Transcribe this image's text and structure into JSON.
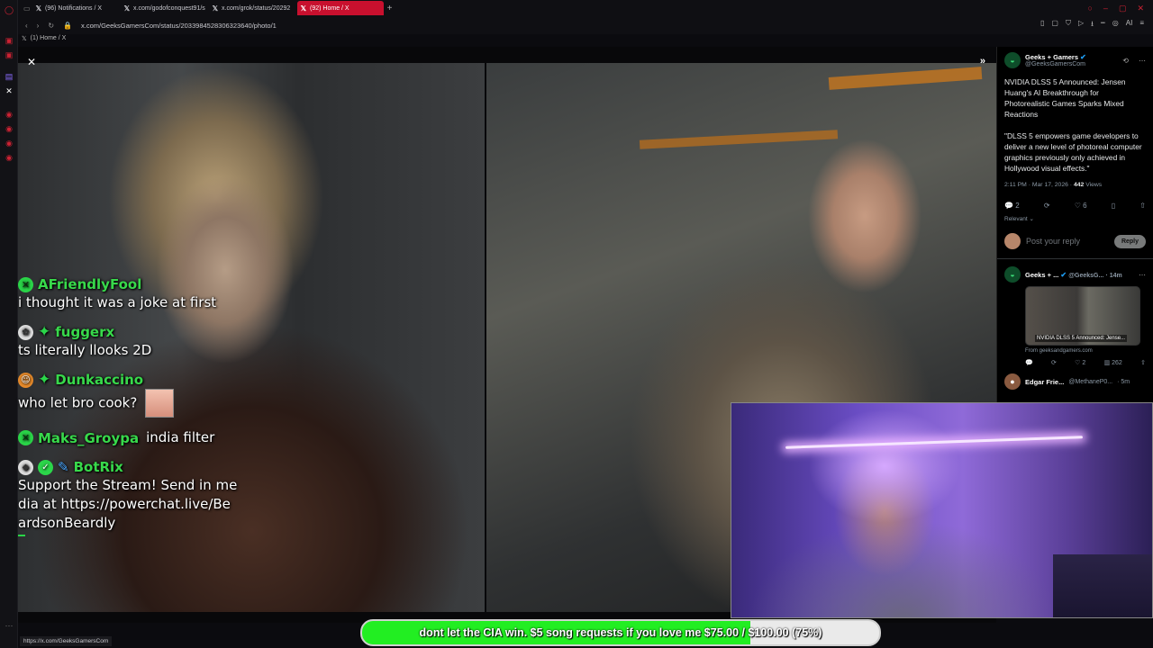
{
  "browser": {
    "tabs": [
      {
        "label": "(96) Notifications / X",
        "active": false
      },
      {
        "label": "x.com/godofconquest91/s",
        "active": false
      },
      {
        "label": "x.com/grok/status/20292",
        "active": false
      },
      {
        "label": "(92) Home / X",
        "active": true
      }
    ],
    "url": "x.com/GeeksGamersCom/status/2033984528306323640/photo/1",
    "breadcrumb": "(1) Home / X",
    "status_url": "https://x.com/GeeksGamersCom",
    "ai_label": "AI"
  },
  "chat": {
    "messages": [
      {
        "user": "AFriendlyFool",
        "text": "i thought it was a joke at first"
      },
      {
        "user": "fuggerx",
        "text": "ts literally llooks 2D"
      },
      {
        "user": "Dunkaccino",
        "text": "who let bro cook?"
      },
      {
        "user": "Maks_Groypa",
        "text": "india filter"
      },
      {
        "user": "BotRix",
        "text": "Support the Stream! Send in media at https://powerchat.live/BeardsonBeardly"
      }
    ]
  },
  "tweet": {
    "author": "Geeks + Gamers",
    "handle": "@GeeksGamersCom",
    "title": "NVIDIA DLSS 5 Announced: Jensen Huang's AI Breakthrough for Photorealistic Games Sparks Mixed Reactions",
    "quote": "\"DLSS 5 empowers game developers to deliver a new level of photoreal computer graphics previously only achieved in Hollywood visual effects.\"",
    "time": "2:11 PM · Mar 17, 2026 ·",
    "views_count": "442",
    "views_label": "Views",
    "replies": "2",
    "likes": "6",
    "relevant": "Relevant",
    "reply_placeholder": "Post your reply",
    "reply_button": "Reply"
  },
  "reply_tweet": {
    "author": "Geeks + ...",
    "handle": "@GeeksG...",
    "age": "· 14m",
    "card_caption": "NVIDIA DLSS 5 Announced: Jense...",
    "card_from": "From geeksandgamers.com",
    "likes": "2",
    "views": "262"
  },
  "next_tweet": {
    "author": "Edgar Frie...",
    "handle": "@MethaneP0...",
    "age": "· 5m"
  },
  "donation": {
    "text": "dont let the CIA win. $5 song requests if you love me $75.00 / $100.00 (75%)",
    "progress": 0.75
  },
  "colors": {
    "tab_active": "#c8102e",
    "chat_name": "#38d94b",
    "donation_fill": "#22ee22"
  }
}
